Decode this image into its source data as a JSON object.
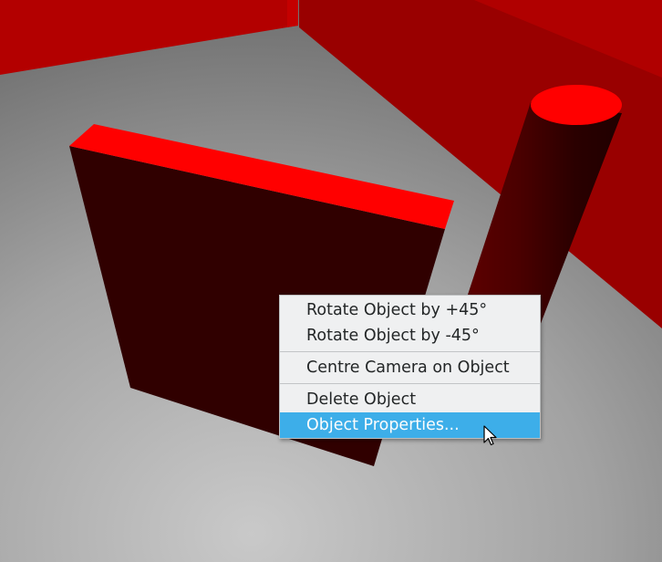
{
  "scene": {
    "floor_color": "#9a9a9a",
    "wall_color": "#b00000",
    "object_top_color": "#ff0000",
    "object_side_color": "#300000"
  },
  "context_menu": {
    "items": [
      {
        "label": "Rotate Object by +45°"
      },
      {
        "label": "Rotate Object by -45°"
      },
      {
        "label": "Centre Camera on Object"
      },
      {
        "label": "Delete Object"
      },
      {
        "label": "Object Properties..."
      }
    ],
    "selected_index": 4,
    "highlight_color": "#3daee9"
  },
  "cursor": {
    "icon": "arrow-cursor-icon"
  }
}
